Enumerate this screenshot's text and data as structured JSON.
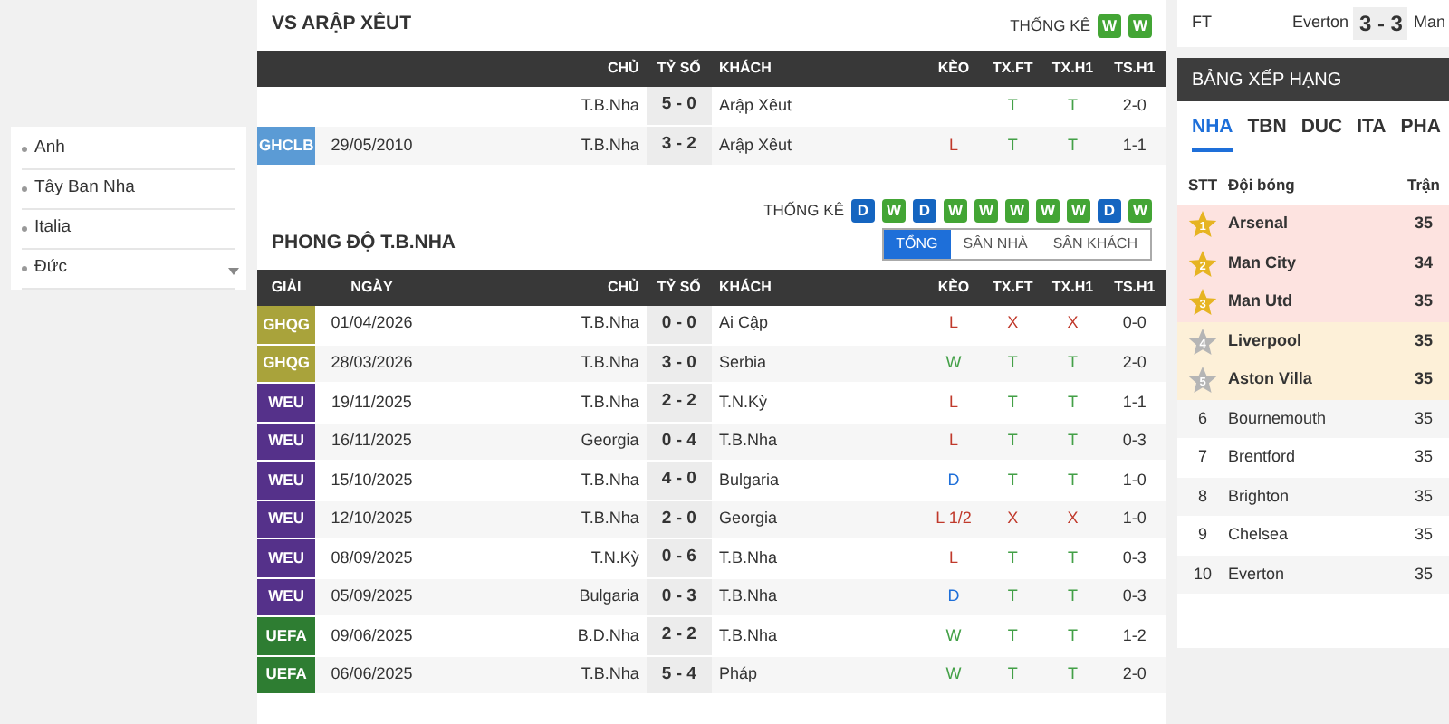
{
  "sidebar": {
    "items": [
      {
        "label": "Anh"
      },
      {
        "label": "Tây Ban Nha"
      },
      {
        "label": "Italia"
      },
      {
        "label": "Đức"
      }
    ]
  },
  "head_to_head": {
    "title": "VS ARẬP XÊUT",
    "stats_label": "THỐNG KÊ",
    "form": [
      {
        "letter": "W",
        "color": "#43a535"
      },
      {
        "letter": "W",
        "color": "#43a535"
      }
    ],
    "columns": [
      "",
      "",
      "CHỦ",
      "TỶ SỐ",
      "KHÁCH",
      "KÈO",
      "TX.FT",
      "TX.H1",
      "TS.H1"
    ],
    "rows": [
      {
        "home": "T.B.Nha",
        "score": "5 - 0",
        "away": "Arập Xêut",
        "tx_ft": {
          "text": "T",
          "color": "#43a047"
        },
        "tx_h1": {
          "text": "T",
          "color": "#43a047"
        },
        "ts_h1": "2-0"
      },
      {
        "league": {
          "text": "GHCLB",
          "color": "#5b9bd5"
        },
        "date": "29/05/2010",
        "home": "T.B.Nha",
        "score": "3 - 2",
        "away": "Arập Xêut",
        "keo": {
          "text": "L",
          "color": "#c0392b"
        },
        "tx_ft": {
          "text": "T",
          "color": "#43a047"
        },
        "tx_h1": {
          "text": "T",
          "color": "#43a047"
        },
        "ts_h1": "1-1"
      }
    ]
  },
  "form_section": {
    "title": "PHONG ĐỘ T.B.NHA",
    "stats_label": "THỐNG KÊ",
    "form": [
      {
        "letter": "D",
        "color": "#1565c0"
      },
      {
        "letter": "W",
        "color": "#43a535"
      },
      {
        "letter": "D",
        "color": "#1565c0"
      },
      {
        "letter": "W",
        "color": "#43a535"
      },
      {
        "letter": "W",
        "color": "#43a535"
      },
      {
        "letter": "W",
        "color": "#43a535"
      },
      {
        "letter": "W",
        "color": "#43a535"
      },
      {
        "letter": "W",
        "color": "#43a535"
      },
      {
        "letter": "D",
        "color": "#1565c0"
      },
      {
        "letter": "W",
        "color": "#43a535"
      }
    ],
    "tabs": [
      {
        "label": "TỔNG",
        "selected": true
      },
      {
        "label": "SÂN NHÀ",
        "selected": false
      },
      {
        "label": "SÂN KHÁCH",
        "selected": false
      }
    ],
    "columns": [
      "GIẢI",
      "NGÀY",
      "CHỦ",
      "TỶ SỐ",
      "KHÁCH",
      "KÈO",
      "TX.FT",
      "TX.H1",
      "TS.H1"
    ],
    "rows": [
      {
        "league": {
          "text": "GHQG",
          "color": "#a9a33b"
        },
        "date": "01/04/2026",
        "home": "T.B.Nha",
        "score": "0 - 0",
        "away": "Ai Cập",
        "keo": {
          "text": "L",
          "color": "#c0392b"
        },
        "tx_ft": {
          "text": "X",
          "color": "#c0392b"
        },
        "tx_h1": {
          "text": "X",
          "color": "#c0392b"
        },
        "ts_h1": "0-0"
      },
      {
        "league": {
          "text": "GHQG",
          "color": "#a9a33b"
        },
        "date": "28/03/2026",
        "home": "T.B.Nha",
        "score": "3 - 0",
        "away": "Serbia",
        "keo": {
          "text": "W",
          "color": "#43a047"
        },
        "tx_ft": {
          "text": "T",
          "color": "#43a047"
        },
        "tx_h1": {
          "text": "T",
          "color": "#43a047"
        },
        "ts_h1": "2-0"
      },
      {
        "league": {
          "text": "WEU",
          "color": "#55318a"
        },
        "date": "19/11/2025",
        "home": "T.B.Nha",
        "score": "2 - 2",
        "away": "T.N.Kỳ",
        "keo": {
          "text": "L",
          "color": "#c0392b"
        },
        "tx_ft": {
          "text": "T",
          "color": "#43a047"
        },
        "tx_h1": {
          "text": "T",
          "color": "#43a047"
        },
        "ts_h1": "1-1"
      },
      {
        "league": {
          "text": "WEU",
          "color": "#55318a"
        },
        "date": "16/11/2025",
        "home": "Georgia",
        "score": "0 - 4",
        "away": "T.B.Nha",
        "keo": {
          "text": "L",
          "color": "#c0392b"
        },
        "tx_ft": {
          "text": "T",
          "color": "#43a047"
        },
        "tx_h1": {
          "text": "T",
          "color": "#43a047"
        },
        "ts_h1": "0-3"
      },
      {
        "league": {
          "text": "WEU",
          "color": "#55318a"
        },
        "date": "15/10/2025",
        "home": "T.B.Nha",
        "score": "4 - 0",
        "away": "Bulgaria",
        "keo": {
          "text": "D",
          "color": "#1e6fd9"
        },
        "tx_ft": {
          "text": "T",
          "color": "#43a047"
        },
        "tx_h1": {
          "text": "T",
          "color": "#43a047"
        },
        "ts_h1": "1-0"
      },
      {
        "league": {
          "text": "WEU",
          "color": "#55318a"
        },
        "date": "12/10/2025",
        "home": "T.B.Nha",
        "score": "2 - 0",
        "away": "Georgia",
        "keo": {
          "text": "L 1/2",
          "color": "#c0392b"
        },
        "tx_ft": {
          "text": "X",
          "color": "#c0392b"
        },
        "tx_h1": {
          "text": "X",
          "color": "#c0392b"
        },
        "ts_h1": "1-0"
      },
      {
        "league": {
          "text": "WEU",
          "color": "#55318a"
        },
        "date": "08/09/2025",
        "home": "T.N.Kỳ",
        "score": "0 - 6",
        "away": "T.B.Nha",
        "keo": {
          "text": "L",
          "color": "#c0392b"
        },
        "tx_ft": {
          "text": "T",
          "color": "#43a047"
        },
        "tx_h1": {
          "text": "T",
          "color": "#43a047"
        },
        "ts_h1": "0-3"
      },
      {
        "league": {
          "text": "WEU",
          "color": "#55318a"
        },
        "date": "05/09/2025",
        "home": "Bulgaria",
        "score": "0 - 3",
        "away": "T.B.Nha",
        "keo": {
          "text": "D",
          "color": "#1e6fd9"
        },
        "tx_ft": {
          "text": "T",
          "color": "#43a047"
        },
        "tx_h1": {
          "text": "T",
          "color": "#43a047"
        },
        "ts_h1": "0-3"
      },
      {
        "league": {
          "text": "UEFA",
          "color": "#2e7d32"
        },
        "date": "09/06/2025",
        "home": "B.D.Nha",
        "score": "2 - 2",
        "away": "T.B.Nha",
        "keo": {
          "text": "W",
          "color": "#43a047"
        },
        "tx_ft": {
          "text": "T",
          "color": "#43a047"
        },
        "tx_h1": {
          "text": "T",
          "color": "#43a047"
        },
        "ts_h1": "1-2"
      },
      {
        "league": {
          "text": "UEFA",
          "color": "#2e7d32"
        },
        "date": "06/06/2025",
        "home": "T.B.Nha",
        "score": "5 - 4",
        "away": "Pháp",
        "keo": {
          "text": "W",
          "color": "#43a047"
        },
        "tx_ft": {
          "text": "T",
          "color": "#43a047"
        },
        "tx_h1": {
          "text": "T",
          "color": "#43a047"
        },
        "ts_h1": "2-0"
      }
    ]
  },
  "live_match": {
    "status": "FT",
    "home": "Everton",
    "score": "3 - 3",
    "away": "Man"
  },
  "standings": {
    "title": "BẢNG XẾP HẠNG",
    "tabs": [
      {
        "label": "NHA",
        "selected": true
      },
      {
        "label": "TBN",
        "selected": false
      },
      {
        "label": "DUC",
        "selected": false
      },
      {
        "label": "ITA",
        "selected": false
      },
      {
        "label": "PHA",
        "selected": false
      }
    ],
    "columns": [
      "STT",
      "Đội bóng",
      "Trận"
    ],
    "rows": [
      {
        "rank": "1",
        "kind": "gold",
        "team": "Arsenal",
        "played": "35"
      },
      {
        "rank": "2",
        "kind": "gold",
        "team": "Man City",
        "played": "34"
      },
      {
        "rank": "3",
        "kind": "gold",
        "team": "Man Utd",
        "played": "35"
      },
      {
        "rank": "4",
        "kind": "silver",
        "team": "Liverpool",
        "played": "35"
      },
      {
        "rank": "5",
        "kind": "silver",
        "team": "Aston Villa",
        "played": "35"
      },
      {
        "rank": "6",
        "kind": "plain",
        "team": "Bournemouth",
        "played": "35"
      },
      {
        "rank": "7",
        "kind": "plain",
        "team": "Brentford",
        "played": "35"
      },
      {
        "rank": "8",
        "kind": "plain",
        "team": "Brighton",
        "played": "35"
      },
      {
        "rank": "9",
        "kind": "plain",
        "team": "Chelsea",
        "played": "35"
      },
      {
        "rank": "10",
        "kind": "plain",
        "team": "Everton",
        "played": "35"
      }
    ]
  }
}
